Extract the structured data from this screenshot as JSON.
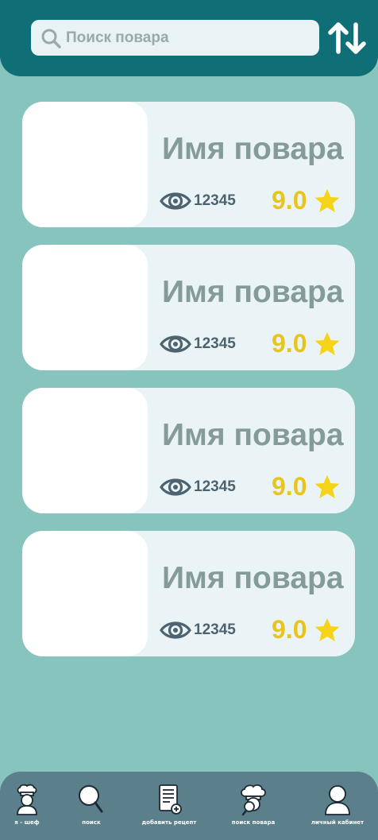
{
  "search": {
    "placeholder": "Поиск повара",
    "value": "",
    "icon": "search-icon"
  },
  "sort": {
    "icon": "sort-arrows-icon"
  },
  "cooks": [
    {
      "name": "Имя повара",
      "views": "12345",
      "rating": "9.0"
    },
    {
      "name": "Имя повара",
      "views": "12345",
      "rating": "9.0"
    },
    {
      "name": "Имя повара",
      "views": "12345",
      "rating": "9.0"
    },
    {
      "name": "Имя повара",
      "views": "12345",
      "rating": "9.0"
    }
  ],
  "nav": {
    "items": [
      {
        "label": "я - шеф",
        "icon": "chef-icon"
      },
      {
        "label": "поиск",
        "icon": "magnifier-icon"
      },
      {
        "label": "добавить рецепт",
        "icon": "add-recipe-icon"
      },
      {
        "label": "поиск повара",
        "icon": "cook-search-icon"
      },
      {
        "label": "личный кабинет",
        "icon": "profile-icon"
      }
    ]
  },
  "colors": {
    "background": "#86c4bd",
    "header": "#0f6e76",
    "card": "#eaf4f6",
    "nav": "#5b7f8b",
    "rating": "#e7c41e",
    "star": "#f5d317"
  }
}
